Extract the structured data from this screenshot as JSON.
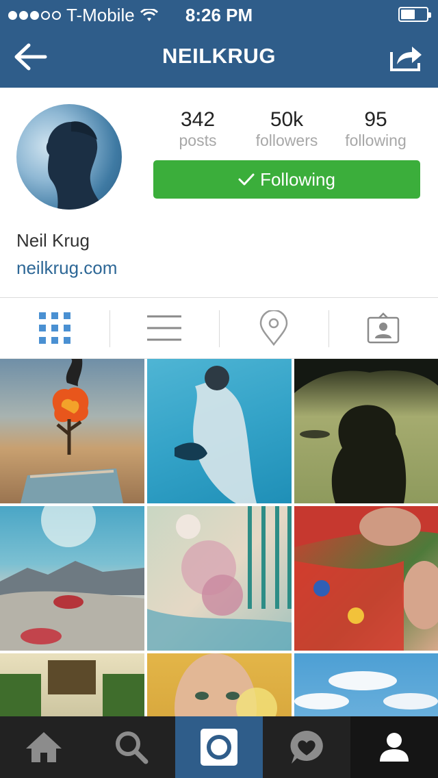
{
  "status_bar": {
    "carrier": "T-Mobile",
    "time": "8:26 PM",
    "signal_bars": 3,
    "signal_total": 5
  },
  "nav": {
    "title": "NEILKRUG",
    "back_icon": "back-arrow-icon",
    "share_icon": "share-icon"
  },
  "profile": {
    "stats": [
      {
        "value": "342",
        "label": "posts"
      },
      {
        "value": "50k",
        "label": "followers"
      },
      {
        "value": "95",
        "label": "following"
      }
    ],
    "follow_label": "Following",
    "name": "Neil Krug",
    "website": "neilkrug.com"
  },
  "tabs": [
    {
      "icon": "grid-view-icon",
      "active": true
    },
    {
      "icon": "list-view-icon",
      "active": false
    },
    {
      "icon": "location-pin-icon",
      "active": false
    },
    {
      "icon": "tagged-photos-icon",
      "active": false
    }
  ],
  "bottom_nav": [
    {
      "icon": "home-icon"
    },
    {
      "icon": "search-icon"
    },
    {
      "icon": "camera-icon"
    },
    {
      "icon": "activity-icon"
    },
    {
      "icon": "profile-icon",
      "active": true
    }
  ],
  "colors": {
    "brand_blue": "#2f5d8a",
    "follow_green": "#3bae3b",
    "link_blue": "#2d6796",
    "active_tab_blue": "#4a90d2"
  }
}
